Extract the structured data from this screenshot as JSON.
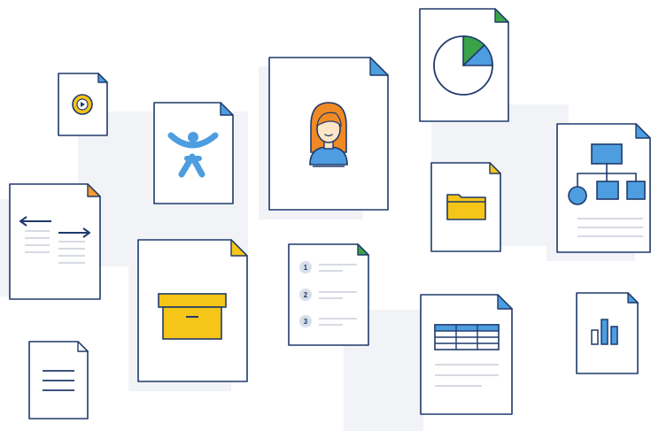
{
  "list_doc": {
    "items": [
      "1",
      "2",
      "3"
    ]
  },
  "colors": {
    "outline": "#1f3a6b",
    "paper": "#ffffff",
    "fold_blue": "#4d9de0",
    "fold_green": "#3aa34a",
    "fold_yellow": "#f5c518",
    "fold_orange": "#f79a2d",
    "yellow": "#f5c518",
    "blue": "#4d9de0",
    "hair": "#f08a24",
    "gray_line": "#c8ced8",
    "shadow": "#f1f3f6"
  },
  "icons": [
    "video-play-icon",
    "atlassian-logo-icon",
    "person-avatar-icon",
    "pie-chart-icon",
    "arrows-exchange-icon",
    "folder-icon",
    "org-chart-icon",
    "archive-box-icon",
    "numbered-list-icon",
    "table-icon",
    "bar-chart-icon",
    "text-lines-icon"
  ]
}
